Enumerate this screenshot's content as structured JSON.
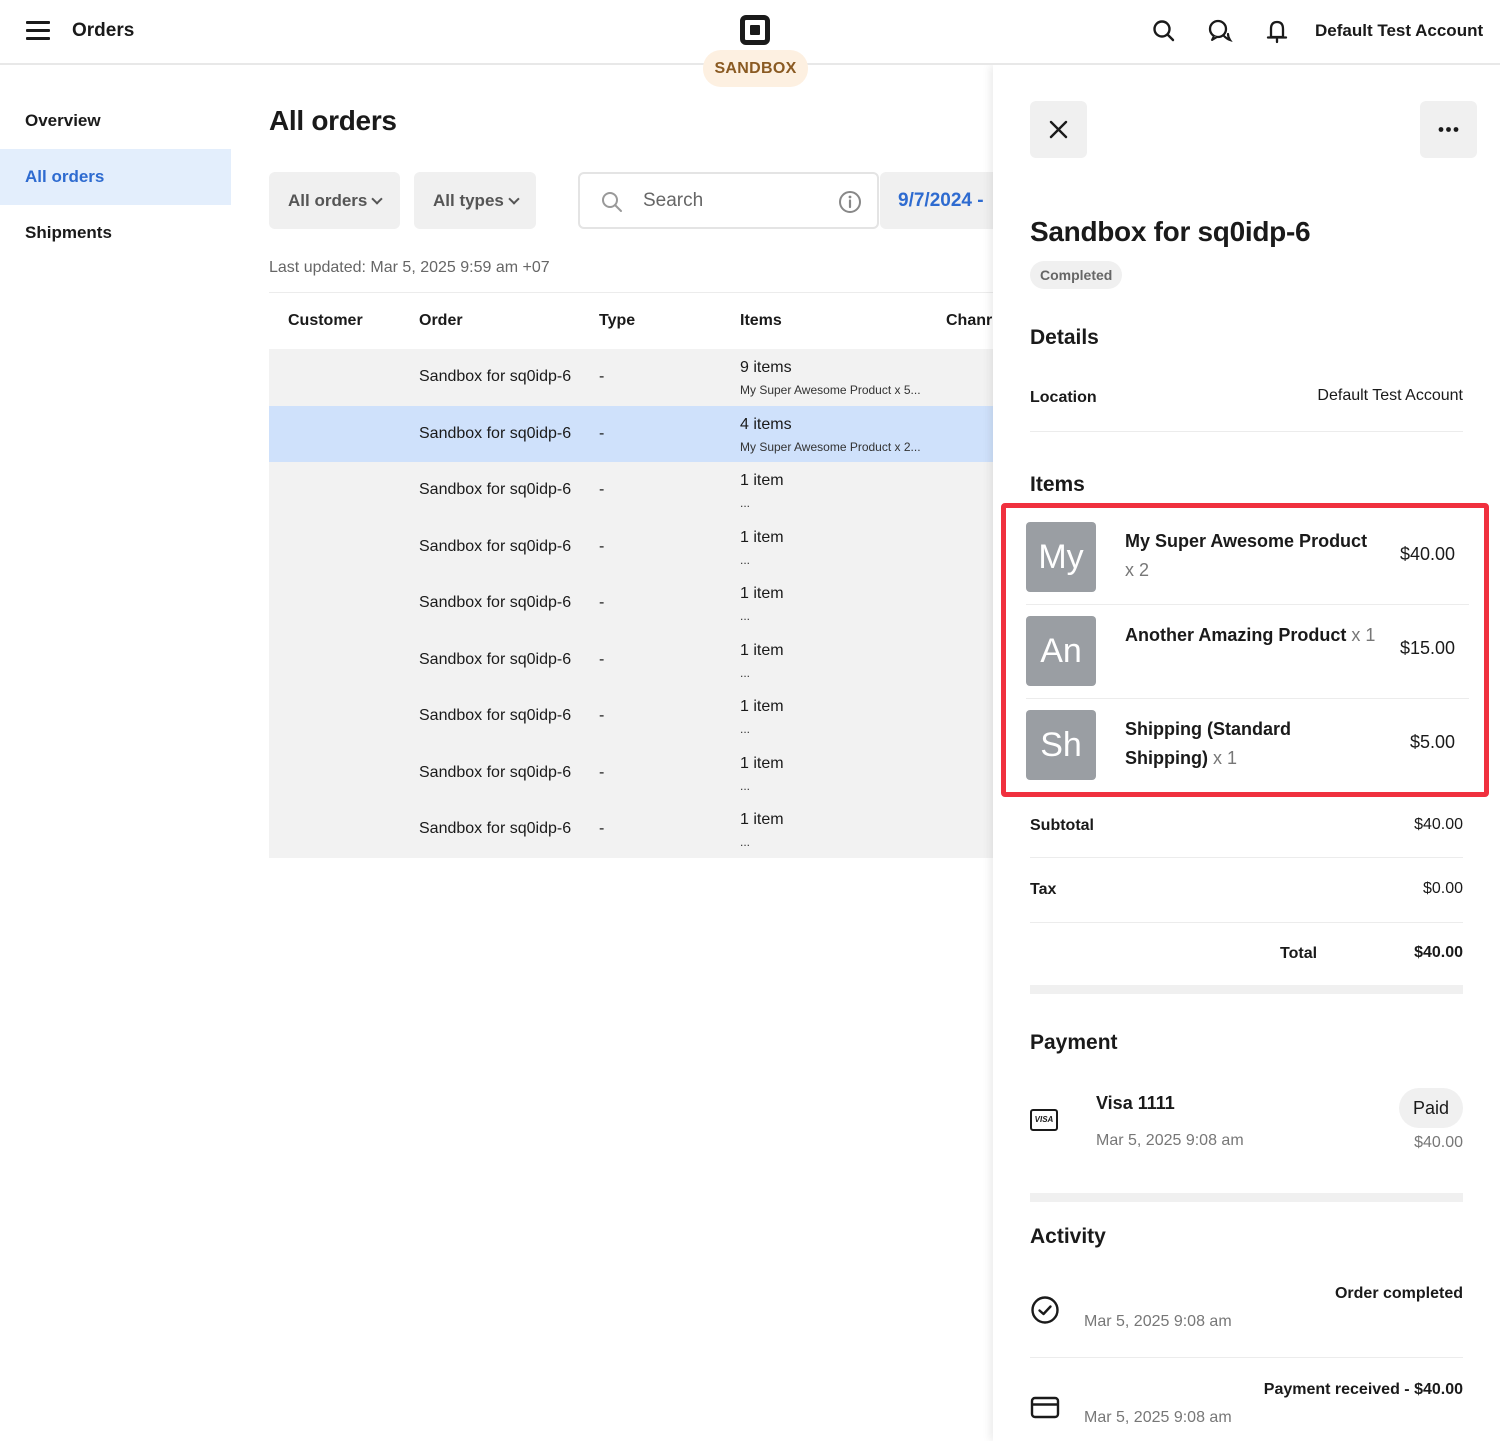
{
  "topbar": {
    "app_title": "Orders",
    "environment_badge": "SANDBOX",
    "account_name": "Default Test Account",
    "icons": [
      "menu-icon",
      "square-logo-icon",
      "search-icon",
      "chat-icon",
      "bell-icon"
    ]
  },
  "sidebar": {
    "items": [
      {
        "label": "Overview",
        "active": false
      },
      {
        "label": "All orders",
        "active": true
      },
      {
        "label": "Shipments",
        "active": false
      }
    ]
  },
  "main": {
    "title": "All orders",
    "filters": {
      "orders_filter": "All orders",
      "types_filter": "All types",
      "search_placeholder": "Search",
      "date_range": "9/7/2024 -"
    },
    "last_updated": "Last updated: Mar 5, 2025 9:59 am +07",
    "table": {
      "columns": [
        "Customer",
        "Order",
        "Type",
        "Items",
        "Chanr"
      ],
      "rows": [
        {
          "customer": "",
          "order": "Sandbox for sq0idp-6",
          "type": "-",
          "items": "9 items",
          "items_detail": "My Super Awesome Product x 5...",
          "selected": false
        },
        {
          "customer": "",
          "order": "Sandbox for sq0idp-6",
          "type": "-",
          "items": "4 items",
          "items_detail": "My Super Awesome Product x 2...",
          "selected": true
        },
        {
          "customer": "",
          "order": "Sandbox for sq0idp-6",
          "type": "-",
          "items": "1 item",
          "items_detail": "...",
          "selected": false
        },
        {
          "customer": "",
          "order": "Sandbox for sq0idp-6",
          "type": "-",
          "items": "1 item",
          "items_detail": "...",
          "selected": false
        },
        {
          "customer": "",
          "order": "Sandbox for sq0idp-6",
          "type": "-",
          "items": "1 item",
          "items_detail": "...",
          "selected": false
        },
        {
          "customer": "",
          "order": "Sandbox for sq0idp-6",
          "type": "-",
          "items": "1 item",
          "items_detail": "...",
          "selected": false
        },
        {
          "customer": "",
          "order": "Sandbox for sq0idp-6",
          "type": "-",
          "items": "1 item",
          "items_detail": "...",
          "selected": false
        },
        {
          "customer": "",
          "order": "Sandbox for sq0idp-6",
          "type": "-",
          "items": "1 item",
          "items_detail": "...",
          "selected": false
        },
        {
          "customer": "",
          "order": "Sandbox for sq0idp-6",
          "type": "-",
          "items": "1 item",
          "items_detail": "...",
          "selected": false
        }
      ]
    }
  },
  "drawer": {
    "title": "Sandbox for sq0idp-6",
    "status": "Completed",
    "details": {
      "heading": "Details",
      "location_label": "Location",
      "location_value": "Default Test Account"
    },
    "items": {
      "heading": "Items",
      "list": [
        {
          "thumb": "My",
          "name": "My Super Awesome Product",
          "qty": "x 2",
          "price": "$40.00"
        },
        {
          "thumb": "An",
          "name": "Another Amazing Product",
          "qty": "x 1",
          "price": "$15.00"
        },
        {
          "thumb": "Sh",
          "name": "Shipping (Standard Shipping)",
          "qty": "x 1",
          "price": "$5.00"
        }
      ]
    },
    "totals": {
      "subtotal_label": "Subtotal",
      "subtotal": "$40.00",
      "tax_label": "Tax",
      "tax": "$0.00",
      "total_label": "Total",
      "total": "$40.00"
    },
    "payment": {
      "heading": "Payment",
      "card_icon_text": "VISA",
      "card": "Visa 1111",
      "date": "Mar 5, 2025 9:08 am",
      "status": "Paid",
      "amount": "$40.00"
    },
    "activity": {
      "heading": "Activity",
      "events": [
        {
          "icon": "check-circle-icon",
          "title": "Order completed",
          "date": "Mar 5, 2025 9:08 am"
        },
        {
          "icon": "credit-card-icon",
          "title": "Payment received - $40.00",
          "date": "Mar 5, 2025 9:08 am"
        }
      ]
    }
  },
  "colors": {
    "accent_blue": "#2e6bd0",
    "selected_row": "#cfe1fb",
    "sidebar_active": "#e3eefc",
    "highlight_border": "#f0303e",
    "sandbox_badge_bg": "#fdf0e1",
    "sandbox_badge_text": "#8a5a22"
  }
}
